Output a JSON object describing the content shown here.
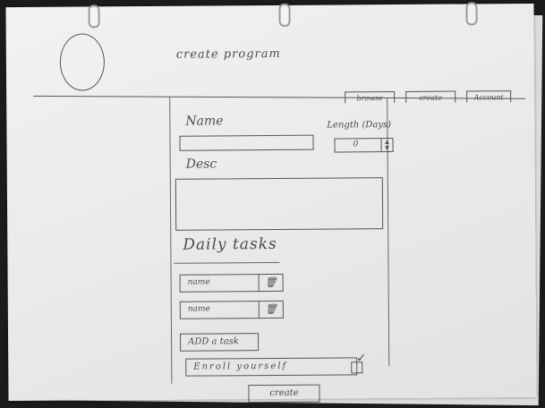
{
  "header": {
    "title": "create program",
    "nav": [
      "browse",
      "create",
      "Account"
    ]
  },
  "form": {
    "name_label": "Name",
    "length_label": "Length (Days)",
    "length_value": "0",
    "desc_label": "Desc",
    "daily_tasks_heading": "Daily tasks",
    "tasks": [
      "name",
      "name"
    ],
    "add_task_label": "ADD a task",
    "enroll_label": "Enroll yourself",
    "enroll_checked": true,
    "create_label": "create"
  }
}
